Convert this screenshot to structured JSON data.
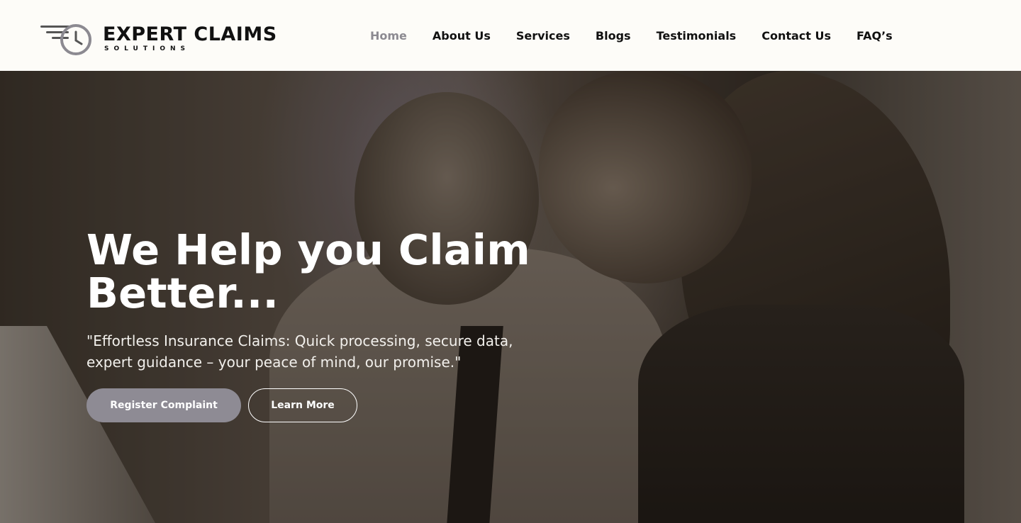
{
  "brand": {
    "title": "EXPERT CLAIMS",
    "subtitle": "SOLUTIONS"
  },
  "nav": {
    "items": [
      {
        "label": "Home",
        "active": true
      },
      {
        "label": "About Us"
      },
      {
        "label": "Services"
      },
      {
        "label": "Blogs"
      },
      {
        "label": "Testimonials"
      },
      {
        "label": "Contact Us"
      },
      {
        "label": "FAQ’s"
      }
    ]
  },
  "hero": {
    "title": "We Help you Claim Better...",
    "subtitle": "\"Effortless Insurance Claims: Quick processing, secure data, expert guidance – your peace of mind, our promise.\"",
    "primary_button": "Register Complaint",
    "secondary_button": "Learn More"
  },
  "colors": {
    "header_bg": "#fdfcf8",
    "nav_active": "#8c8a91",
    "primary_button": "#8e8b94",
    "text_dark": "#111111"
  }
}
